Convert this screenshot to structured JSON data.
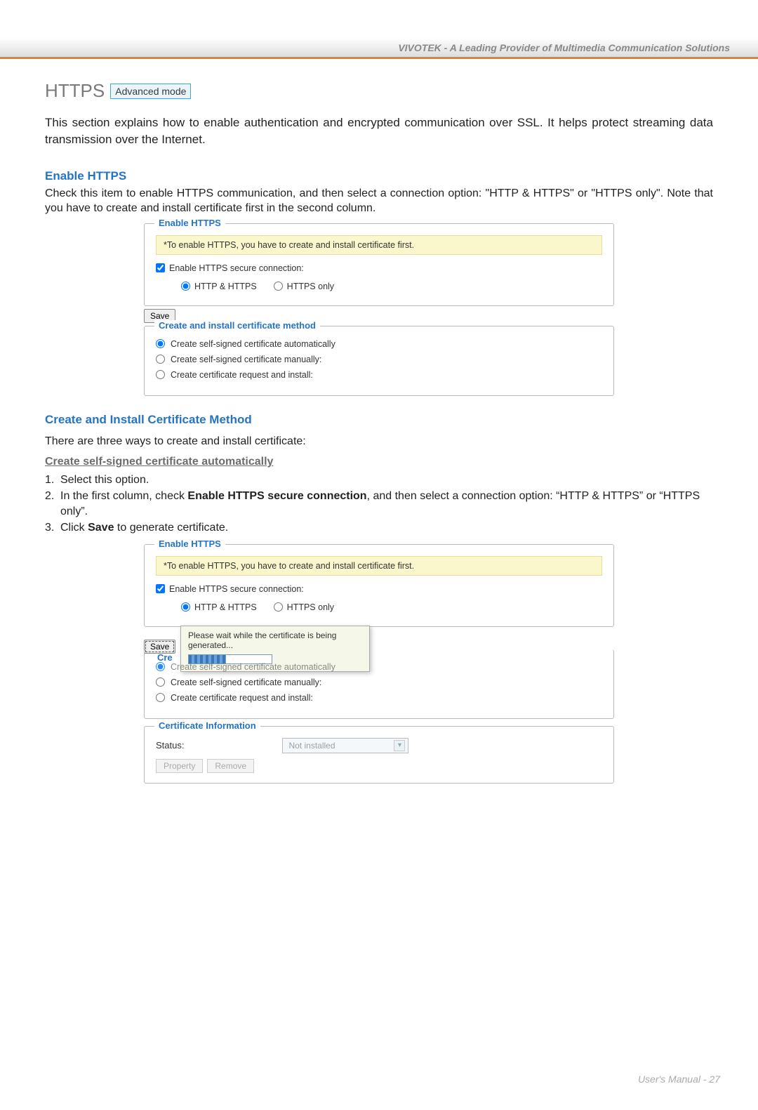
{
  "header": {
    "tagline": "VIVOTEK - A Leading Provider of Multimedia Communication Solutions"
  },
  "page_title": "HTTPS",
  "badge": "Advanced mode",
  "intro": "This section explains how to enable authentication and encrypted communication over SSL. It helps protect streaming data transmission over the Internet.",
  "section1": {
    "title": "Enable HTTPS",
    "desc": "Check this item to enable HTTPS communication, and then select a connection option: \"HTTP & HTTPS\" or \"HTTPS only\". Note that you have to create and install certificate first in the second column."
  },
  "panel1": {
    "enable_legend": "Enable HTTPS",
    "notice": "*To enable HTTPS, you have to create and install certificate first.",
    "checkbox_label": "Enable HTTPS secure connection:",
    "radio_a": "HTTP & HTTPS",
    "radio_b": "HTTPS only",
    "save": "Save",
    "cert_legend": "Create and install certificate method",
    "opt1": "Create self-signed certificate automatically",
    "opt2": "Create self-signed certificate manually:",
    "opt3": "Create certificate request and install:"
  },
  "section2": {
    "title": "Create and Install Certificate Method",
    "lead": "There are three ways to create and install certificate:",
    "sub": "Create self-signed certificate automatically",
    "step1": "Select this option.",
    "step2_pre": "In the first column, check ",
    "step2_bold": "Enable HTTPS secure connection",
    "step2_post": ", and then select a connection option: “HTTP & HTTPS” or “HTTPS only”.",
    "step3_pre": "Click ",
    "step3_bold": "Save",
    "step3_post": " to generate certificate."
  },
  "panel2": {
    "enable_legend": "Enable HTTPS",
    "notice": "*To enable HTTPS, you have to create and install certificate first.",
    "checkbox_label": "Enable HTTPS secure connection:",
    "radio_a": "HTTP & HTTPS",
    "radio_b": "HTTPS only",
    "save": "Save",
    "tooltip": "Please wait while the certificate is being generated...",
    "obscured_label": "Create self-signed certificate automatically",
    "cr_prefix": "Cre",
    "opt2": "Create self-signed certificate manually:",
    "opt3": "Create certificate request and install:",
    "cert_info_legend": "Certificate Information",
    "status_label": "Status:",
    "status_value": "Not installed",
    "property_btn": "Property",
    "remove_btn": "Remove"
  },
  "footer": "User's Manual - 27"
}
